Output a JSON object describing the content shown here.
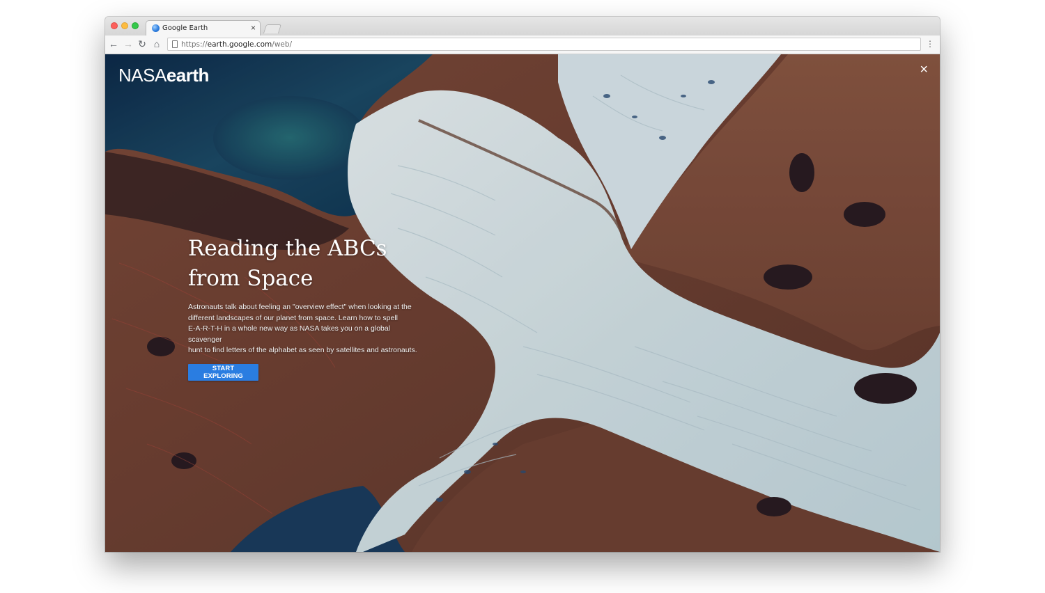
{
  "browser": {
    "tab": {
      "title": "Google Earth",
      "close_glyph": "×",
      "favicon": "google-earth-icon"
    },
    "address": {
      "scheme": "https://",
      "host": "earth.google.com",
      "path": "/web/"
    },
    "nav": {
      "back": "←",
      "forward": "→",
      "reload": "↻",
      "home": "⌂",
      "menu": "⋮"
    }
  },
  "overlay": {
    "brand_part1": "NASA",
    "brand_part2": "earth",
    "close_glyph": "×",
    "title_line1": "Reading the ABCs",
    "title_line2": "from Space",
    "description_lines": [
      "Astronauts talk about feeling an \"overview effect\" when looking at the",
      "different landscapes of our planet from space. Learn how to spell",
      "E-A-R-T-H in a whole new way as NASA takes you on a global scavenger",
      "hunt to find letters of the alphabet as seen by satellites and astronauts."
    ],
    "cta_label": "START EXPLORING",
    "accent": "#2a7de1"
  }
}
